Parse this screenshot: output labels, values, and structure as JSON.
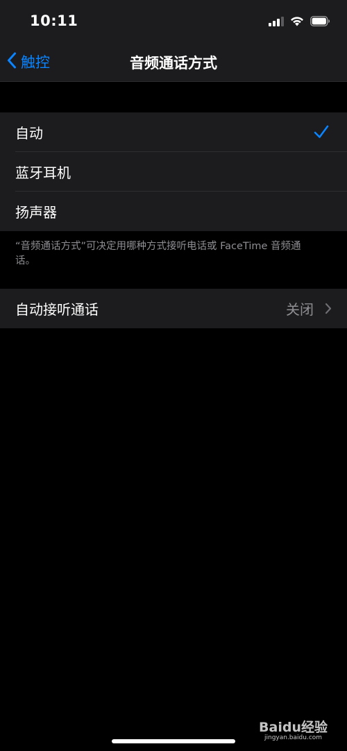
{
  "status_bar": {
    "time": "10:11",
    "icons": [
      "cellular-signal-icon",
      "wifi-icon",
      "battery-icon"
    ]
  },
  "nav": {
    "back_label": "触控",
    "title": "音频通话方式"
  },
  "routing_options": {
    "items": [
      {
        "label": "自动",
        "selected": true
      },
      {
        "label": "蓝牙耳机",
        "selected": false
      },
      {
        "label": "扬声器",
        "selected": false
      }
    ],
    "footer": "“音频通话方式”可决定用哪种方式接听电话或 FaceTime 音频通话。"
  },
  "auto_answer": {
    "label": "自动接听通话",
    "value": "关闭"
  },
  "watermark": {
    "logo": "Baidu经验",
    "url": "jingyan.baidu.com"
  },
  "colors": {
    "background": "#000000",
    "group_background": "#1c1c1e",
    "accent": "#0a84ff",
    "secondary_text": "#8e8e93"
  }
}
